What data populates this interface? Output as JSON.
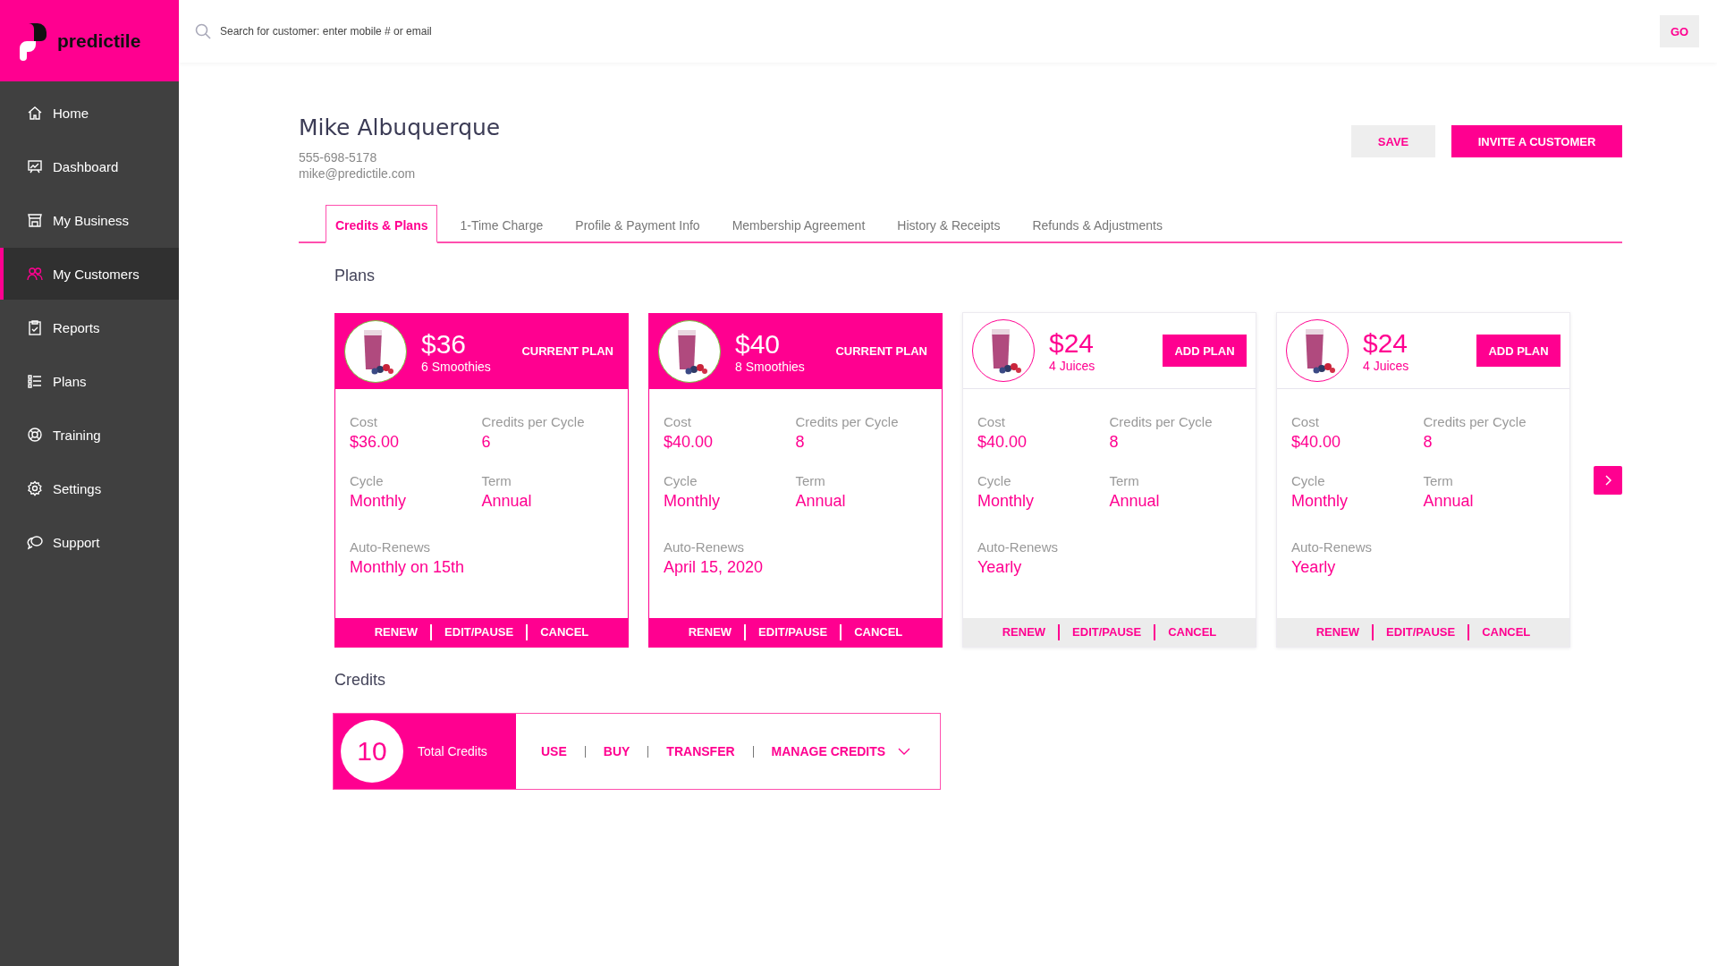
{
  "brand": {
    "name": "predictile"
  },
  "sidebar": {
    "items": [
      {
        "label": "Home",
        "selected": false
      },
      {
        "label": "Dashboard",
        "selected": false
      },
      {
        "label": "My Business",
        "selected": false
      },
      {
        "label": "My Customers",
        "selected": true
      },
      {
        "label": "Reports",
        "selected": false
      },
      {
        "label": "Plans",
        "selected": false
      },
      {
        "label": "Training",
        "selected": false
      },
      {
        "label": "Settings",
        "selected": false
      },
      {
        "label": "Support",
        "selected": false
      }
    ]
  },
  "search": {
    "placeholder": "Search for customer: enter mobile # or email",
    "button": "GO"
  },
  "customer": {
    "name": "Mike Albuquerque",
    "phone": "555-698-5178",
    "email": "mike@predictile.com"
  },
  "header_buttons": [
    {
      "label": "SAVE",
      "kind": "secondary"
    },
    {
      "label": "INVITE A CUSTOMER",
      "kind": "primary"
    }
  ],
  "tabs": [
    {
      "label": "Credits & Plans",
      "selected": true
    },
    {
      "label": "1-Time Charge",
      "selected": false
    },
    {
      "label": "Profile & Payment Info",
      "selected": false
    },
    {
      "label": "Membership Agreement",
      "selected": false
    },
    {
      "label": "History & Receipts",
      "selected": false
    },
    {
      "label": "Refunds & Adjustments",
      "selected": false
    }
  ],
  "plans": {
    "title": "Plans",
    "items": [
      {
        "price": "$36",
        "subtitle": "6 Smoothies",
        "current": true,
        "action": "CURRENT PLAN",
        "fields": [
          {
            "label": "Cost",
            "value": "$36.00"
          },
          {
            "label": "Credits per Cycle",
            "value": "6"
          },
          {
            "label": "Cycle",
            "value": "Monthly"
          },
          {
            "label": "Term",
            "value": "Annual"
          },
          {
            "label": "Auto-Renews",
            "value": "Monthly on 15th"
          }
        ],
        "footer": [
          "RENEW",
          "EDIT/PAUSE",
          "CANCEL"
        ]
      },
      {
        "price": "$40",
        "subtitle": "8 Smoothies",
        "current": true,
        "action": "CURRENT PLAN",
        "fields": [
          {
            "label": "Cost",
            "value": "$40.00"
          },
          {
            "label": "Credits per Cycle",
            "value": "8"
          },
          {
            "label": "Cycle",
            "value": "Monthly"
          },
          {
            "label": "Term",
            "value": "Annual"
          },
          {
            "label": "Auto-Renews",
            "value": "April 15, 2020"
          }
        ],
        "footer": [
          "RENEW",
          "EDIT/PAUSE",
          "CANCEL"
        ]
      },
      {
        "price": "$24",
        "subtitle": "4 Juices",
        "current": false,
        "action": "ADD PLAN",
        "fields": [
          {
            "label": "Cost",
            "value": "$40.00"
          },
          {
            "label": "Credits per Cycle",
            "value": "8"
          },
          {
            "label": "Cycle",
            "value": "Monthly"
          },
          {
            "label": "Term",
            "value": "Annual"
          },
          {
            "label": "Auto-Renews",
            "value": "Yearly"
          }
        ],
        "footer": [
          "RENEW",
          "EDIT/PAUSE",
          "CANCEL"
        ]
      },
      {
        "price": "$24",
        "subtitle": "4 Juices",
        "current": false,
        "action": "ADD PLAN",
        "fields": [
          {
            "label": "Cost",
            "value": "$40.00"
          },
          {
            "label": "Credits per Cycle",
            "value": "8"
          },
          {
            "label": "Cycle",
            "value": "Monthly"
          },
          {
            "label": "Term",
            "value": "Annual"
          },
          {
            "label": "Auto-Renews",
            "value": "Yearly"
          }
        ],
        "footer": [
          "RENEW",
          "EDIT/PAUSE",
          "CANCEL"
        ]
      }
    ]
  },
  "credits": {
    "title": "Credits",
    "total": "10",
    "total_label": "Total Credits",
    "actions": [
      "USE",
      "BUY",
      "TRANSFER",
      "MANAGE CREDITS"
    ]
  }
}
